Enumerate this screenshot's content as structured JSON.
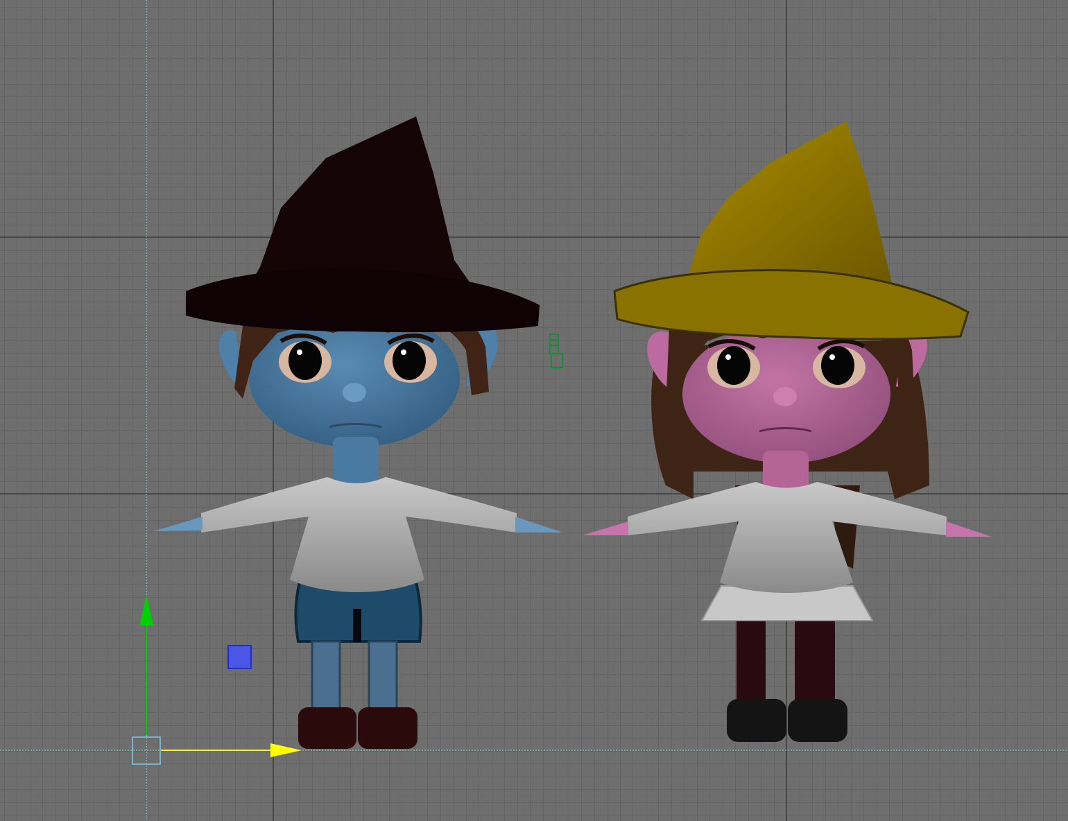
{
  "viewport": {
    "view": "front",
    "grid": true,
    "grid_color": "#5a5a5a",
    "major_grid_color": "#3c3c3c",
    "background_color": "#6e6e6e"
  },
  "scene": {
    "characters": [
      {
        "id": "boy-witch",
        "skin_color": "#4f7fa6",
        "hat_color": "#140406",
        "hair_color": "#3e2415",
        "shirt_color": "#bfbfbf",
        "shorts_color": "#1e4a66",
        "legs_color": "#4a6f8f",
        "shoes_color": "#2a0a0a"
      },
      {
        "id": "girl-witch",
        "skin_color": "#b8699b",
        "hat_color": "#8a7200",
        "hair_color": "#3e2415",
        "shirt_color": "#bfbfbf",
        "skirt_color": "#c8c8c8",
        "legs_color": "#2a0a12",
        "shoes_color": "#141414"
      }
    ]
  },
  "manipulator": {
    "y_axis_color": "#00d000",
    "x_axis_color": "#ffff00",
    "z_axis_color": "#4b56e6",
    "center_handle_color": "#7ec8e3",
    "axis_line_color": "#7fe3d8"
  },
  "light_icon": {
    "icon": "light-icon",
    "color": "#1a8a3a"
  }
}
